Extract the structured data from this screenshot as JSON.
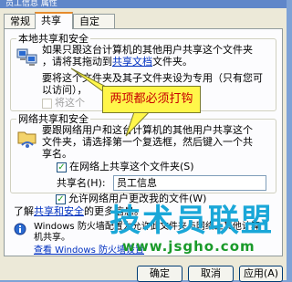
{
  "window": {
    "title": "员工信息 属性"
  },
  "tabs": [
    {
      "label": "常规"
    },
    {
      "label": "共享"
    },
    {
      "label": "自定义"
    }
  ],
  "local_group": {
    "legend": "本地共享和安全",
    "line1": "如果只跟这台计算机的其他用户共享这个文件夹",
    "line2_a": "，请将其拖动到",
    "line2_link": "共享文档",
    "line2_b": "文件夹。",
    "line3": "要将这个文件夹及其子文件夹设为专用（只有您可",
    "line4": "以访问），",
    "private_checkbox_label": "将这个"
  },
  "callout": {
    "text": "两项都必须打钩"
  },
  "network_group": {
    "legend": "网络共享和安全",
    "line1": "要跟网络用户和这台计算机的其他用户共享这个",
    "line2": "文件夹，请选择第一个复选框，然后键入一个共",
    "line3": "享名。",
    "share_checkbox_label": "在网络上共享这个文件夹(S)",
    "share_checked": true,
    "share_name_label": "共享名(H):",
    "share_name_value": "员工信息",
    "allow_change_label": "允许网络用户更改我的文件(W)",
    "allow_change_checked": true,
    "learn_link": "共享和安全",
    "learn_prefix": "了解",
    "learn_suffix": "的更多信息。"
  },
  "firewall": {
    "line1": "Windows 防火墙配置为允许此文件夹与网络上其他计算",
    "line2": "机共享。",
    "settings_link": "查看 Windows 防火墙设置"
  },
  "buttons": {
    "ok": "确定",
    "cancel": "取消",
    "apply": "应用(A)"
  },
  "watermark": {
    "text": "技术员联盟",
    "url": "www.jsgho.com"
  }
}
